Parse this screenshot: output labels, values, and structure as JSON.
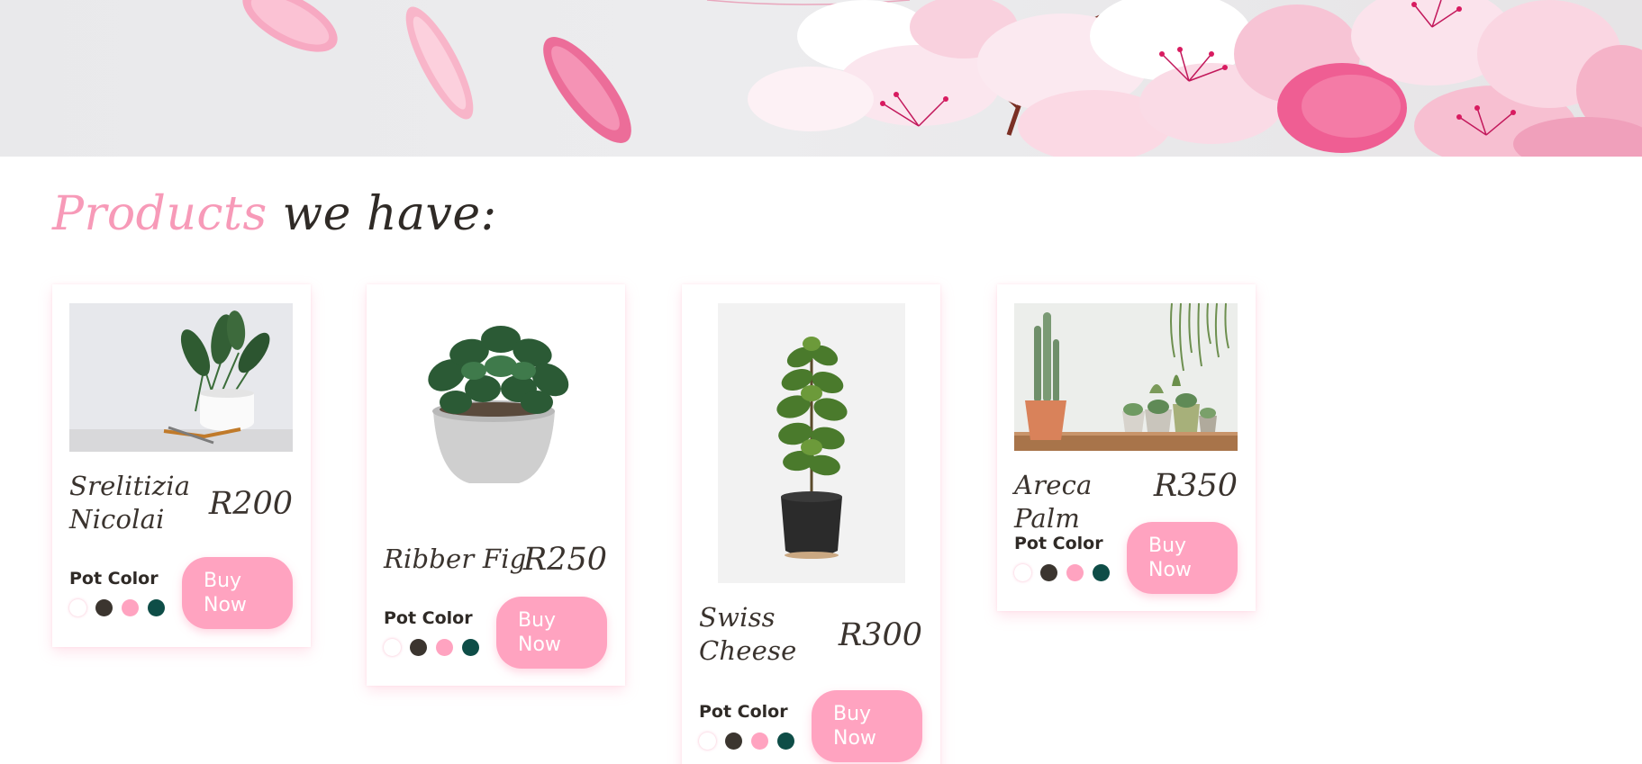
{
  "heading": {
    "accent": "Products",
    "rest": " we have:",
    "accent_color": "#f79ab8"
  },
  "pot_color_label": "Pot Color",
  "buy_label": "Buy Now",
  "swatch_colors": [
    "#ffffff",
    "#3b352f",
    "#ffa3c0",
    "#0e4d47"
  ],
  "brand_pink": "#ffa3c0",
  "products": [
    {
      "name": "Srelitizia Nicolai",
      "price": "R200"
    },
    {
      "name": "Ribber Fig",
      "price": "R250"
    },
    {
      "name": "Swiss Cheese",
      "price": "R300"
    },
    {
      "name": "Areca Palm",
      "price": "R350"
    }
  ]
}
